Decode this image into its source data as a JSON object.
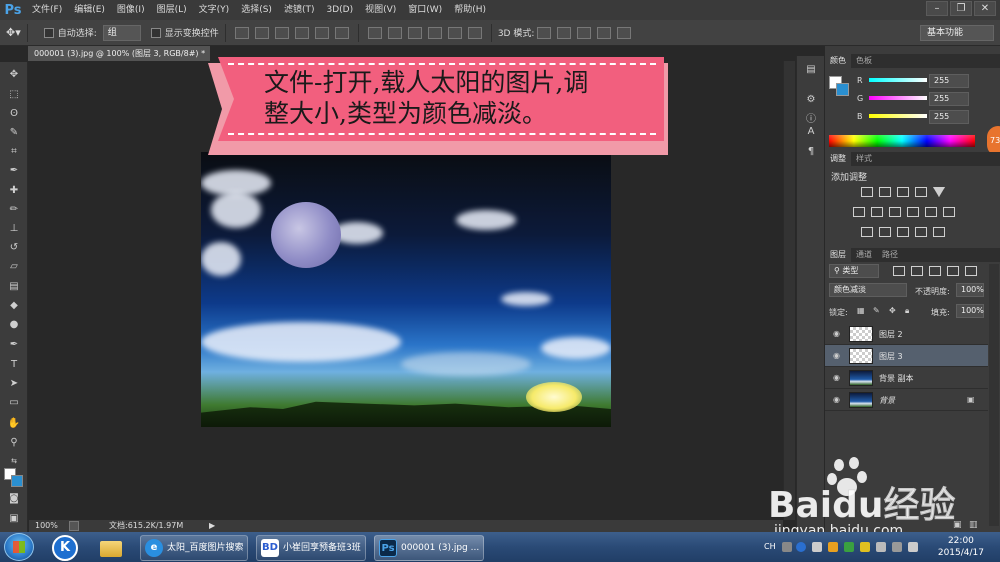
{
  "menu": {
    "logo": "Ps",
    "items": [
      "文件(F)",
      "编辑(E)",
      "图像(I)",
      "图层(L)",
      "文字(Y)",
      "选择(S)",
      "滤镜(T)",
      "3D(D)",
      "视图(V)",
      "窗口(W)",
      "帮助(H)"
    ]
  },
  "window_controls": {
    "minimize": "–",
    "restore": "❐",
    "close": "✕"
  },
  "options": {
    "auto_select_label": "自动选择:",
    "auto_select_value": "组",
    "show_transform_label": "显示变换控件",
    "mode_3d_label": "3D 模式:",
    "workspace": "基本功能"
  },
  "document": {
    "tab_title": "000001 (3).jpg @ 100% (图层 3, RGB/8#) *",
    "tab_close": "×",
    "zoom": "100%",
    "doc_info": "文档:615.2K/1.97M"
  },
  "banner": {
    "line1": "文件-打开,载人太阳的图片,调",
    "line2": "整大小,类型为颜色减淡。",
    "front_color": "#f25f7e",
    "back_color": "#f19aa8"
  },
  "color_panel": {
    "tabs": [
      "颜色",
      "色板"
    ],
    "r_label": "R",
    "g_label": "G",
    "b_label": "B",
    "r": "255",
    "g": "255",
    "b": "255"
  },
  "adjust_panel": {
    "tabs": [
      "调整",
      "样式"
    ],
    "heading": "添加调整"
  },
  "layers_panel": {
    "tabs": [
      "图层",
      "通道",
      "路径"
    ],
    "filter_label": "类型",
    "blend_mode": "颜色减淡",
    "opacity_label": "不透明度:",
    "opacity": "100%",
    "lock_label": "锁定:",
    "fill_label": "填充:",
    "fill": "100%",
    "layers": [
      {
        "name": "图层 2",
        "selected": false,
        "thumb": "transparent"
      },
      {
        "name": "图层 3",
        "selected": true,
        "thumb": "transparent"
      },
      {
        "name": "背景 副本",
        "selected": false,
        "thumb": "photo"
      },
      {
        "name": "背景",
        "selected": false,
        "thumb": "photo",
        "locked": true
      }
    ]
  },
  "badge": "73",
  "taskbar": {
    "items": [
      {
        "label": "",
        "icon": "K"
      },
      {
        "label": "",
        "icon": "folder"
      },
      {
        "label": "太阳_百度图片搜索",
        "icon": "browser"
      },
      {
        "label": "小崔回享预备班3班",
        "icon": "BD"
      },
      {
        "label": "000001 (3).jpg ...",
        "icon": "Ps"
      }
    ],
    "lang": "CH",
    "time": "22:00",
    "date": "2015/4/17"
  },
  "watermark": {
    "brand": "Baidu经验",
    "url": "jingyan.baidu.com"
  }
}
